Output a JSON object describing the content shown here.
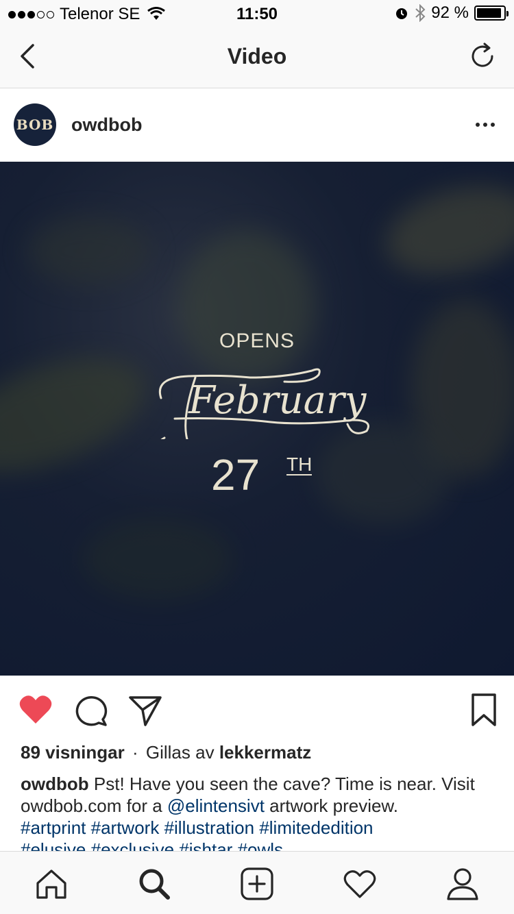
{
  "status_bar": {
    "carrier": "Telenor SE",
    "time": "11:50",
    "battery": "92 %",
    "battery_level": 0.92,
    "signal_bars_filled": 3,
    "signal_bars_total": 5
  },
  "nav": {
    "title": "Video",
    "back_icon": "chevron-left-icon",
    "refresh_icon": "refresh-icon"
  },
  "post": {
    "username": "owdbob",
    "avatar_text": "BOB",
    "more_icon": "ellipsis-icon",
    "video": {
      "opens": "OPENS",
      "month": "February",
      "day": "27",
      "suffix": "TH"
    },
    "views": "89 visningar",
    "separator": "·",
    "liked_by_prefix": "Gillas av",
    "liked_by_user": "lekkermatz",
    "caption": {
      "user": "owdbob",
      "text_1": "Pst! Have you seen the cave? Time is near. Visit owdbob.com for a",
      "mention": "@elintensivt",
      "text_2": "artwork preview.",
      "tags": [
        "#artprint",
        "#artwork",
        "#illustration",
        "#limitededition",
        "#elusive",
        "#exclusive",
        "#ishtar",
        "#owls"
      ]
    }
  },
  "colors": {
    "like_red": "#ed4956",
    "link_blue": "#003569",
    "text": "#262626",
    "video_bg": "#0f1930"
  }
}
